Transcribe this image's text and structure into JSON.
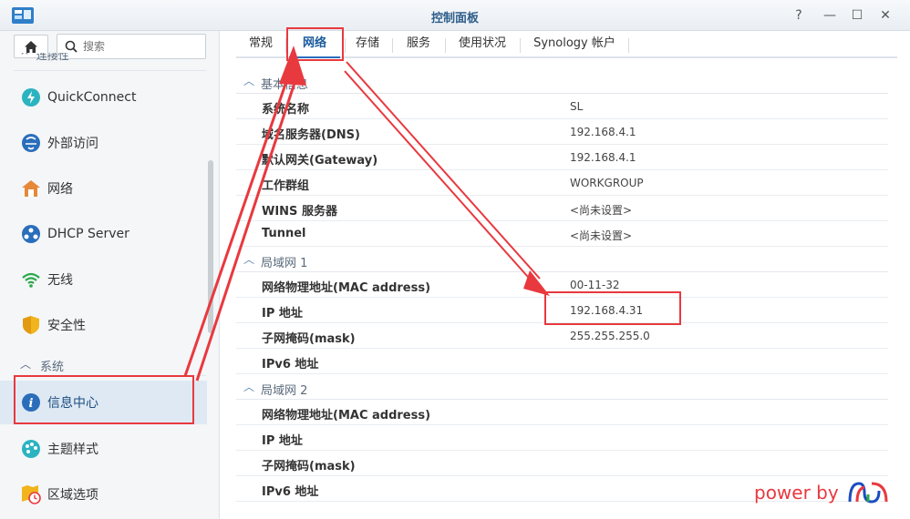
{
  "window": {
    "title": "控制面板",
    "buttons": [
      "?",
      "—",
      "☐",
      "✕"
    ]
  },
  "sidebar": {
    "search_placeholder": "搜索",
    "cut_category": "连接性",
    "items": [
      {
        "label": "QuickConnect",
        "icon": "quickconnect-icon"
      },
      {
        "label": "外部访问",
        "icon": "external-access-icon"
      },
      {
        "label": "网络",
        "icon": "network-icon"
      },
      {
        "label": "DHCP Server",
        "icon": "dhcp-icon"
      },
      {
        "label": "无线",
        "icon": "wireless-icon"
      },
      {
        "label": "安全性",
        "icon": "security-icon"
      }
    ],
    "system_category": "系统",
    "system_items": [
      {
        "label": "信息中心",
        "icon": "info-icon",
        "active": true
      },
      {
        "label": "主题样式",
        "icon": "theme-icon"
      },
      {
        "label": "区域选项",
        "icon": "region-icon"
      }
    ]
  },
  "tabs": [
    {
      "label": "常规"
    },
    {
      "label": "网络",
      "active": true
    },
    {
      "label": "存储"
    },
    {
      "label": "服务"
    },
    {
      "label": "使用状况"
    },
    {
      "label": "Synology 帐户"
    }
  ],
  "sections": [
    {
      "title": "基本信息",
      "rows": [
        {
          "key": "系统名称",
          "value": "SL"
        },
        {
          "key": "域名服务器(DNS)",
          "value": "192.168.4.1"
        },
        {
          "key": "默认网关(Gateway)",
          "value": "192.168.4.1"
        },
        {
          "key": "工作群组",
          "value": "WORKGROUP"
        },
        {
          "key": "WINS 服务器",
          "value": "<尚未设置>"
        },
        {
          "key": "Tunnel",
          "value": "<尚未设置>"
        }
      ]
    },
    {
      "title": "局域网 1",
      "rows": [
        {
          "key": "网络物理地址(MAC address)",
          "value": "00-11-32"
        },
        {
          "key": "IP 地址",
          "value": "192.168.4.31"
        },
        {
          "key": "子网掩码(mask)",
          "value": "255.255.255.0"
        },
        {
          "key": "IPv6 地址",
          "value": ""
        }
      ]
    },
    {
      "title": "局域网 2",
      "rows": [
        {
          "key": "网络物理地址(MAC address)",
          "value": ""
        },
        {
          "key": "IP 地址",
          "value": ""
        },
        {
          "key": "子网掩码(mask)",
          "value": ""
        },
        {
          "key": "IPv6 地址",
          "value": ""
        }
      ]
    }
  ],
  "watermark": "power by",
  "colors": {
    "annotation": "#e8393f",
    "accent": "#2a6ebb",
    "active_bg": "#dfe9f3"
  }
}
